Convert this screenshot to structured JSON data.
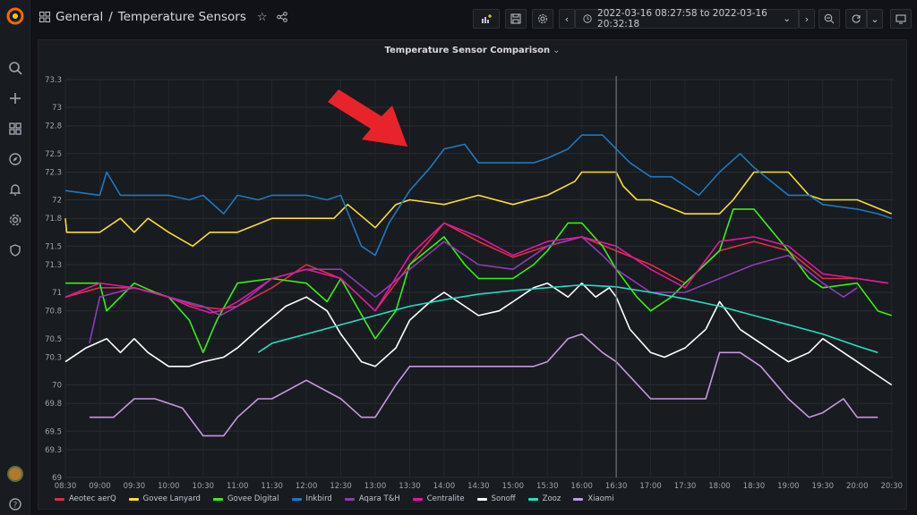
{
  "breadcrumb": {
    "folder": "General",
    "separator": "/",
    "title": "Temperature Sensors"
  },
  "time_range": {
    "label": "2022-03-16 08:27:58 to 2022-03-16 20:32:18"
  },
  "panel": {
    "title": "Temperature Sensor Comparison"
  },
  "colors": {
    "accent": "#f2cc0c",
    "background": "#111217",
    "panel": "#181b1f"
  },
  "icons": [
    "grafana-logo",
    "search-icon",
    "plus-icon",
    "dashboards-icon",
    "explore-icon",
    "alert-bell-icon",
    "gear-icon",
    "shield-icon",
    "help-icon",
    "star-icon",
    "share-icon",
    "add-panel-icon",
    "save-icon",
    "settings-icon",
    "clock-icon",
    "zoom-out-icon",
    "refresh-icon",
    "tv-icon"
  ],
  "chart_data": {
    "type": "line",
    "title": "Temperature Sensor Comparison",
    "x_ticks": [
      "08:30",
      "09:00",
      "09:30",
      "10:00",
      "10:30",
      "11:00",
      "11:30",
      "12:00",
      "12:30",
      "13:00",
      "13:30",
      "14:00",
      "14:30",
      "15:00",
      "15:30",
      "16:00",
      "16:30",
      "17:00",
      "17:30",
      "18:00",
      "18:30",
      "19:00",
      "19:30",
      "20:00",
      "20:30"
    ],
    "y_ticks": [
      "69",
      "69.3",
      "69.5",
      "69.8",
      "70",
      "70.3",
      "70.5",
      "70.8",
      "71",
      "71.3",
      "71.5",
      "71.8",
      "72",
      "72.3",
      "72.5",
      "72.8",
      "73",
      "73.3"
    ],
    "ylim": [
      69,
      73.3
    ],
    "x_range_hours": [
      8.5,
      20.53
    ],
    "grid": true,
    "legend_position": "bottom-left",
    "series": [
      {
        "name": "Aeotec aerQ",
        "color": "#e02f44",
        "x": [
          8.5,
          9.0,
          9.5,
          10.0,
          10.4,
          10.75,
          11.0,
          11.5,
          12.0,
          12.5,
          13.0,
          13.5,
          14.0,
          14.5,
          15.0,
          15.5,
          16.0,
          16.5,
          17.0,
          17.5,
          18.0,
          18.5,
          19.0,
          19.5,
          20.0,
          20.45
        ],
        "y": [
          70.95,
          71.05,
          71.05,
          70.95,
          70.85,
          70.82,
          70.85,
          71.05,
          71.3,
          71.15,
          70.8,
          71.3,
          71.75,
          71.55,
          71.38,
          71.5,
          71.6,
          71.45,
          71.3,
          71.1,
          71.45,
          71.55,
          71.45,
          71.15,
          71.15,
          71.1
        ]
      },
      {
        "name": "Govee Lanyard",
        "color": "#fade2a",
        "x": [
          8.5,
          8.52,
          9.0,
          9.3,
          9.5,
          9.7,
          10.0,
          10.35,
          10.6,
          11.0,
          11.5,
          12.0,
          12.4,
          12.6,
          13.0,
          13.3,
          13.5,
          14.0,
          14.5,
          15.0,
          15.5,
          15.9,
          16.0,
          16.5,
          16.6,
          16.8,
          17.0,
          17.5,
          18.0,
          18.2,
          18.5,
          19.0,
          19.3,
          19.5,
          20.0,
          20.5
        ],
        "y": [
          71.8,
          71.65,
          71.65,
          71.8,
          71.65,
          71.8,
          71.65,
          71.5,
          71.65,
          71.65,
          71.8,
          71.8,
          71.8,
          71.95,
          71.7,
          71.95,
          72.0,
          71.95,
          72.05,
          71.95,
          72.05,
          72.2,
          72.3,
          72.3,
          72.15,
          72.0,
          72.0,
          71.85,
          71.85,
          72.0,
          72.3,
          72.3,
          72.05,
          72.0,
          72.0,
          71.85
        ]
      },
      {
        "name": "Govee Digital",
        "color": "#37f112",
        "x": [
          8.5,
          9.0,
          9.1,
          9.5,
          9.8,
          10.0,
          10.3,
          10.5,
          10.7,
          11.0,
          11.5,
          12.0,
          12.3,
          12.5,
          13.0,
          13.3,
          13.5,
          14.0,
          14.3,
          14.5,
          15.0,
          15.3,
          15.5,
          15.8,
          16.0,
          16.3,
          16.5,
          16.8,
          17.0,
          17.3,
          17.5,
          18.0,
          18.2,
          18.5,
          19.0,
          19.3,
          19.5,
          20.0,
          20.3,
          20.5
        ],
        "y": [
          71.1,
          71.1,
          70.8,
          71.1,
          71.0,
          70.95,
          70.7,
          70.35,
          70.7,
          71.1,
          71.15,
          71.1,
          70.9,
          71.15,
          70.5,
          70.8,
          71.3,
          71.6,
          71.3,
          71.15,
          71.15,
          71.3,
          71.45,
          71.75,
          71.75,
          71.5,
          71.25,
          70.95,
          70.8,
          70.95,
          71.1,
          71.45,
          71.9,
          71.9,
          71.45,
          71.15,
          71.05,
          71.1,
          70.8,
          70.75
        ]
      },
      {
        "name": "Inkbird",
        "color": "#1f78c1",
        "x": [
          8.5,
          9.0,
          9.1,
          9.3,
          9.5,
          10.0,
          10.3,
          10.5,
          10.8,
          11.0,
          11.3,
          11.5,
          12.0,
          12.3,
          12.5,
          12.8,
          13.0,
          13.2,
          13.5,
          13.8,
          14.0,
          14.3,
          14.5,
          15.0,
          15.3,
          15.5,
          15.8,
          16.0,
          16.3,
          16.5,
          16.7,
          17.0,
          17.3,
          17.5,
          17.7,
          18.0,
          18.3,
          18.5,
          19.0,
          19.3,
          19.5,
          20.0,
          20.3,
          20.5
        ],
        "y": [
          72.1,
          72.05,
          72.3,
          72.05,
          72.05,
          72.05,
          72.0,
          72.05,
          71.85,
          72.05,
          72.0,
          72.05,
          72.05,
          72.0,
          72.05,
          71.5,
          71.4,
          71.75,
          72.1,
          72.35,
          72.55,
          72.6,
          72.4,
          72.4,
          72.4,
          72.45,
          72.55,
          72.7,
          72.7,
          72.55,
          72.4,
          72.25,
          72.25,
          72.15,
          72.05,
          72.3,
          72.5,
          72.35,
          72.05,
          72.05,
          71.95,
          71.9,
          71.85,
          71.8
        ]
      },
      {
        "name": "Aqara T&H",
        "color": "#8f3bb8",
        "x": [
          8.85,
          9.0,
          9.5,
          10.0,
          10.5,
          10.75,
          11.0,
          11.5,
          12.0,
          12.5,
          13.0,
          13.5,
          14.0,
          14.5,
          15.0,
          15.5,
          16.0,
          16.3,
          16.5,
          17.0,
          17.5,
          18.0,
          18.5,
          19.0,
          19.5,
          19.8,
          20.0
        ],
        "y": [
          70.45,
          70.95,
          71.05,
          70.95,
          70.85,
          70.75,
          70.85,
          71.15,
          71.25,
          71.25,
          70.95,
          71.25,
          71.55,
          71.3,
          71.25,
          71.5,
          71.6,
          71.4,
          71.25,
          71.0,
          71.0,
          71.15,
          71.3,
          71.4,
          71.1,
          70.95,
          71.05
        ]
      },
      {
        "name": "Centralite",
        "color": "#e017a2",
        "x": [
          8.5,
          9.0,
          9.5,
          10.0,
          10.3,
          10.6,
          10.75,
          11.0,
          11.5,
          12.0,
          12.5,
          13.0,
          13.5,
          14.0,
          14.5,
          15.0,
          15.5,
          16.0,
          16.5,
          17.0,
          17.5,
          18.0,
          18.5,
          19.0,
          19.5,
          20.0,
          20.45
        ],
        "y": [
          70.95,
          71.1,
          71.05,
          70.95,
          70.85,
          70.78,
          70.8,
          70.9,
          71.15,
          71.25,
          71.15,
          70.8,
          71.4,
          71.75,
          71.6,
          71.4,
          71.55,
          71.6,
          71.5,
          71.25,
          71.05,
          71.55,
          71.6,
          71.5,
          71.2,
          71.15,
          71.1
        ]
      },
      {
        "name": "Sonoff",
        "color": "#ffffff",
        "x": [
          8.5,
          8.8,
          9.1,
          9.3,
          9.5,
          9.7,
          10.0,
          10.3,
          10.5,
          10.8,
          11.0,
          11.3,
          11.7,
          12.0,
          12.3,
          12.5,
          12.8,
          13.0,
          13.3,
          13.5,
          13.8,
          14.0,
          14.3,
          14.5,
          14.8,
          15.0,
          15.3,
          15.5,
          15.8,
          16.0,
          16.2,
          16.4,
          16.5,
          16.7,
          17.0,
          17.2,
          17.5,
          17.8,
          18.0,
          18.3,
          18.5,
          18.8,
          19.0,
          19.3,
          19.5,
          19.8,
          20.0,
          20.2,
          20.5
        ],
        "y": [
          70.25,
          70.4,
          70.5,
          70.35,
          70.5,
          70.35,
          70.2,
          70.2,
          70.25,
          70.3,
          70.4,
          70.6,
          70.85,
          70.95,
          70.8,
          70.55,
          70.25,
          70.2,
          70.4,
          70.7,
          70.9,
          71.0,
          70.85,
          70.75,
          70.8,
          70.9,
          71.05,
          71.1,
          70.95,
          71.1,
          70.95,
          71.05,
          70.95,
          70.6,
          70.35,
          70.3,
          70.4,
          70.6,
          70.9,
          70.6,
          70.5,
          70.35,
          70.25,
          70.35,
          70.5,
          70.35,
          70.25,
          70.15,
          70.0
        ]
      },
      {
        "name": "Zooz",
        "color": "#20dfc1",
        "x": [
          11.3,
          11.5,
          12.0,
          12.5,
          13.0,
          13.5,
          14.0,
          14.5,
          15.0,
          15.5,
          16.0,
          16.5,
          17.0,
          17.5,
          18.0,
          18.5,
          19.0,
          19.5,
          20.0,
          20.3
        ],
        "y": [
          70.35,
          70.45,
          70.55,
          70.65,
          70.75,
          70.85,
          70.92,
          70.98,
          71.02,
          71.05,
          71.08,
          71.06,
          71.0,
          70.93,
          70.85,
          70.75,
          70.65,
          70.55,
          70.42,
          70.35
        ]
      },
      {
        "name": "Xiaomi",
        "color": "#ca95e5",
        "x": [
          8.85,
          9.2,
          9.5,
          9.8,
          10.2,
          10.5,
          10.6,
          10.8,
          11.0,
          11.3,
          11.5,
          12.0,
          12.5,
          12.8,
          13.0,
          13.3,
          13.5,
          14.0,
          14.5,
          15.0,
          15.3,
          15.5,
          15.8,
          16.0,
          16.3,
          16.5,
          17.0,
          17.3,
          17.5,
          17.8,
          18.0,
          18.3,
          18.6,
          19.0,
          19.3,
          19.5,
          19.8,
          20.0,
          20.3
        ],
        "y": [
          69.65,
          69.65,
          69.85,
          69.85,
          69.75,
          69.45,
          69.45,
          69.45,
          69.65,
          69.85,
          69.85,
          70.05,
          69.85,
          69.65,
          69.65,
          70.0,
          70.2,
          70.2,
          70.2,
          70.2,
          70.2,
          70.25,
          70.5,
          70.55,
          70.35,
          70.25,
          69.85,
          69.85,
          69.85,
          69.85,
          70.35,
          70.35,
          70.2,
          69.85,
          69.65,
          69.7,
          69.85,
          69.65,
          69.65
        ]
      }
    ]
  },
  "legend": [
    {
      "label": "Aeotec aerQ",
      "color": "#e02f44"
    },
    {
      "label": "Govee Lanyard",
      "color": "#fade2a"
    },
    {
      "label": "Govee Digital",
      "color": "#37f112"
    },
    {
      "label": "Inkbird",
      "color": "#1f78c1"
    },
    {
      "label": "Aqara T&H",
      "color": "#8f3bb8"
    },
    {
      "label": "Centralite",
      "color": "#e017a2"
    },
    {
      "label": "Sonoff",
      "color": "#ffffff"
    },
    {
      "label": "Zooz",
      "color": "#20dfc1"
    },
    {
      "label": "Xiaomi",
      "color": "#ca95e5"
    }
  ]
}
